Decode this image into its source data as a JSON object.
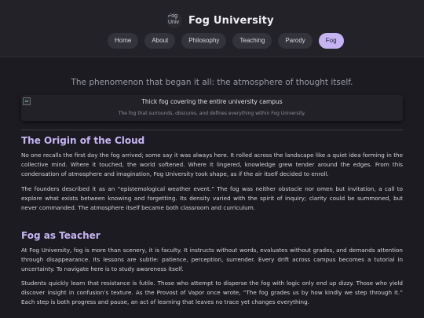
{
  "header": {
    "logo_text": "Fog Univ",
    "brand_name": "Fog University",
    "nav": [
      {
        "label": "Home",
        "active": false
      },
      {
        "label": "About",
        "active": false
      },
      {
        "label": "Philosophy",
        "active": false
      },
      {
        "label": "Teaching",
        "active": false
      },
      {
        "label": "Parody",
        "active": false
      },
      {
        "label": "Fog",
        "active": true
      }
    ]
  },
  "main": {
    "tagline": "The phenomenon that began it all: the atmosphere of thought itself.",
    "figure": {
      "alt": "Thick fog covering the entire university campus",
      "caption": "The fog that surrounds, obscures, and defines everything within Fog University."
    },
    "sections": [
      {
        "heading": "The Origin of the Cloud",
        "paragraphs": [
          "No one recalls the first day the fog arrived; some say it was always here. It rolled across the landscape like a quiet idea forming in the collective mind. Where it touched, the world softened. Where it lingered, knowledge grew tender around the edges. From this condensation of atmosphere and imagination, Fog University took shape, as if the air itself decided to enroll.",
          "The founders described it as an “epistemological weather event.” The fog was neither obstacle nor omen but invitation, a call to explore what exists between knowing and forgetting. Its density varied with the spirit of inquiry; clarity could be summoned, but never commanded. The atmosphere itself became both classroom and curriculum."
        ]
      },
      {
        "heading": "Fog as Teacher",
        "paragraphs": [
          "At Fog University, fog is more than scenery, it is faculty. It instructs without words, evaluates without grades, and demands attention through disappearance. Its lessons are subtle: patience, perception, surrender. Every drift across campus becomes a tutorial in uncertainty. To navigate here is to study awareness itself.",
          "Students quickly learn that resistance is futile. Those who attempt to disperse the fog with logic only end up dizzy. Those who yield discover insight in confusion’s texture. As the Provost of Vapor once wrote, “The fog grades us by how kindly we step through it.” Each step is both progress and pause, an act of learning that leaves no trace yet changes everything."
        ]
      }
    ]
  }
}
